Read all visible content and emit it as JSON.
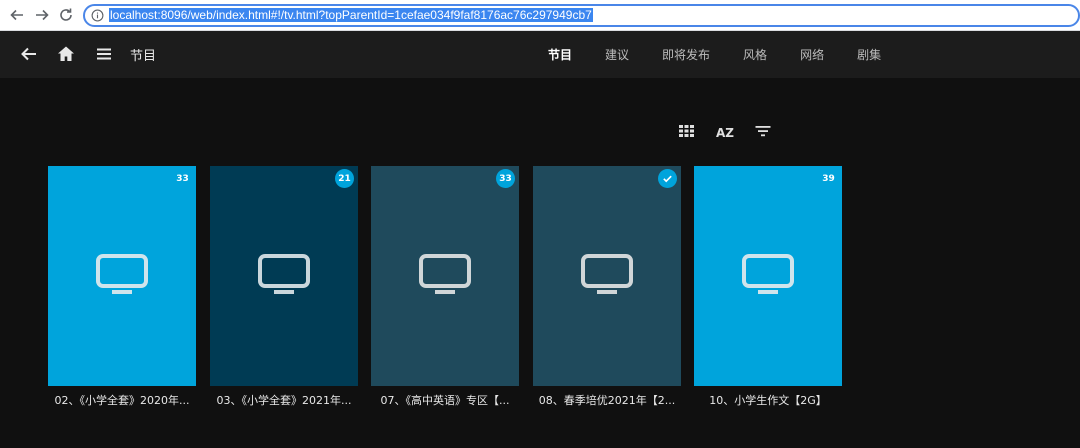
{
  "browser": {
    "url": "localhost:8096/web/index.html#!/tv.html?topParentId=1cefae034f9faf8176ac76c297949cb7",
    "back_icon": "arrow-left-icon",
    "forward_icon": "arrow-right-icon",
    "reload_icon": "reload-icon",
    "info_icon": "info-icon"
  },
  "header": {
    "title": "节目",
    "tabs": [
      {
        "label": "节目",
        "active": true
      },
      {
        "label": "建议",
        "active": false
      },
      {
        "label": "即将发布",
        "active": false
      },
      {
        "label": "风格",
        "active": false
      },
      {
        "label": "网络",
        "active": false
      },
      {
        "label": "剧集",
        "active": false
      }
    ]
  },
  "toolbar": {
    "icons": [
      "grid-view-icon",
      "sort-az-icon",
      "filter-icon"
    ],
    "sort_label": "AZ"
  },
  "cards": [
    {
      "title": "02、《小学全套》2020年...",
      "badge": "33",
      "color": "#00a4dc",
      "played": false
    },
    {
      "title": "03、《小学全套》2021年...",
      "badge": "21",
      "color": "#003b54",
      "played": false
    },
    {
      "title": "07、《高中英语》专区【...",
      "badge": "33",
      "color": "#1f4a5c",
      "played": false
    },
    {
      "title": "08、春季培优2021年【2...",
      "badge": "",
      "color": "#1f4a5c",
      "played": true
    },
    {
      "title": "10、小学生作文【2G】",
      "badge": "39",
      "color": "#00a4dc",
      "played": false
    }
  ],
  "colors": {
    "accent": "#00a4dc",
    "header_bg": "#1c1c1c",
    "page_bg": "#101010"
  }
}
